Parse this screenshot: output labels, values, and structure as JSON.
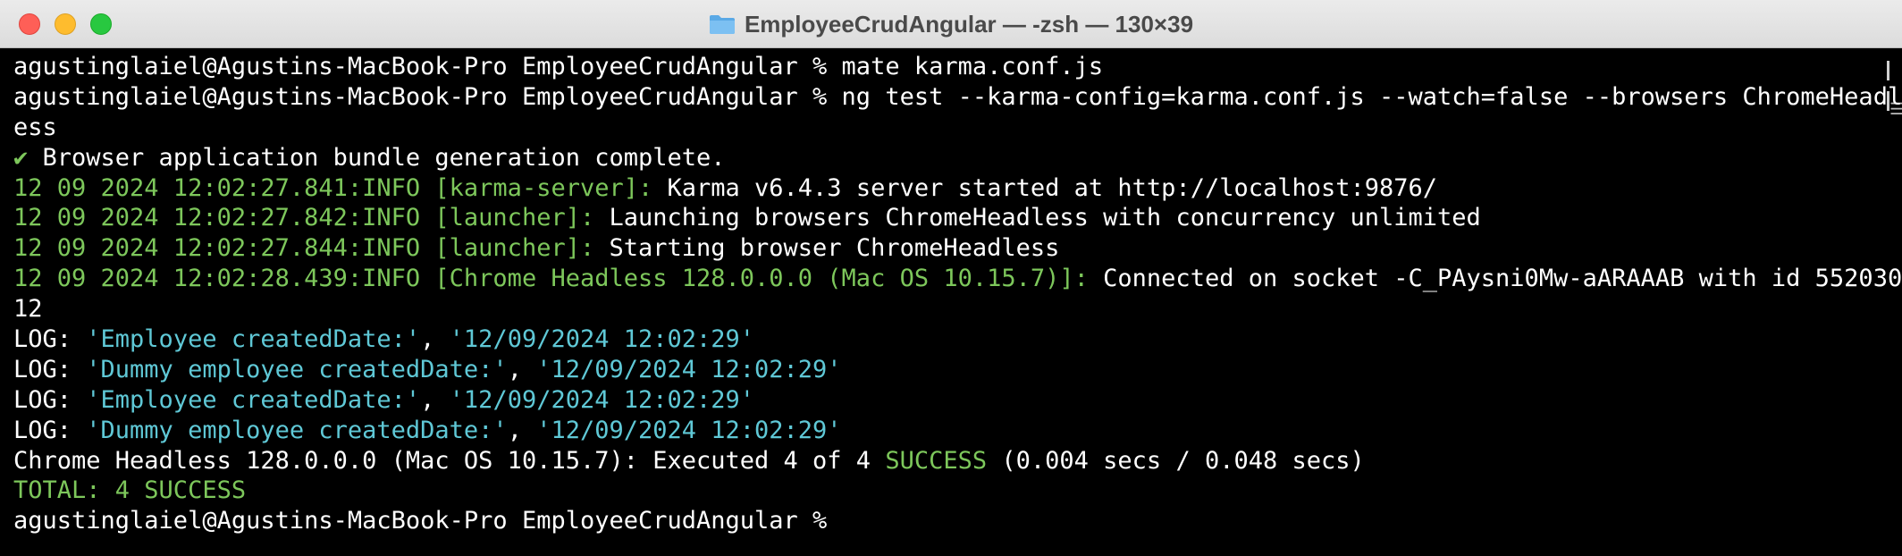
{
  "window": {
    "title": "EmployeeCrudAngular — -zsh — 130×39",
    "icon": "folder-icon"
  },
  "terminal": {
    "lines": [
      [
        {
          "text": "agustinglaiel@Agustins-MacBook-Pro EmployeeCrudAngular % mate karma.conf.js",
          "color": "white"
        }
      ],
      [
        {
          "text": "agustinglaiel@Agustins-MacBook-Pro EmployeeCrudAngular % ng test --karma-config=karma.conf.js --watch=false --browsers ChromeHeadl",
          "color": "white"
        }
      ],
      [
        {
          "text": "ess",
          "color": "white"
        }
      ],
      [
        {
          "text": "✔ ",
          "color": "green"
        },
        {
          "text": "Browser application bundle generation complete.",
          "color": "white"
        }
      ],
      [
        {
          "text": "12 09 2024 12:02:27.841:INFO [karma-server]: ",
          "color": "green"
        },
        {
          "text": "Karma v6.4.3 server started at http://localhost:9876/",
          "color": "white"
        }
      ],
      [
        {
          "text": "12 09 2024 12:02:27.842:INFO [launcher]: ",
          "color": "green"
        },
        {
          "text": "Launching browsers ChromeHeadless with concurrency unlimited",
          "color": "white"
        }
      ],
      [
        {
          "text": "12 09 2024 12:02:27.844:INFO [launcher]: ",
          "color": "green"
        },
        {
          "text": "Starting browser ChromeHeadless",
          "color": "white"
        }
      ],
      [
        {
          "text": "12 09 2024 12:02:28.439:INFO [Chrome Headless 128.0.0.0 (Mac OS 10.15.7)]: ",
          "color": "green"
        },
        {
          "text": "Connected on socket -C_PAysni0Mw-aARAAAB with id 552030",
          "color": "white"
        }
      ],
      [
        {
          "text": "12",
          "color": "white"
        }
      ],
      [
        {
          "text": "LOG: ",
          "color": "white"
        },
        {
          "text": "'Employee createdDate:'",
          "color": "cyan"
        },
        {
          "text": ", ",
          "color": "white"
        },
        {
          "text": "'12/09/2024 12:02:29'",
          "color": "cyan"
        }
      ],
      [
        {
          "text": "LOG: ",
          "color": "white"
        },
        {
          "text": "'Dummy employee createdDate:'",
          "color": "cyan"
        },
        {
          "text": ", ",
          "color": "white"
        },
        {
          "text": "'12/09/2024 12:02:29'",
          "color": "cyan"
        }
      ],
      [
        {
          "text": "LOG: ",
          "color": "white"
        },
        {
          "text": "'Employee createdDate:'",
          "color": "cyan"
        },
        {
          "text": ", ",
          "color": "white"
        },
        {
          "text": "'12/09/2024 12:02:29'",
          "color": "cyan"
        }
      ],
      [
        {
          "text": "LOG: ",
          "color": "white"
        },
        {
          "text": "'Dummy employee createdDate:'",
          "color": "cyan"
        },
        {
          "text": ", ",
          "color": "white"
        },
        {
          "text": "'12/09/2024 12:02:29'",
          "color": "cyan"
        }
      ],
      [
        {
          "text": "Chrome Headless 128.0.0.0 (Mac OS 10.15.7): Executed 4 of 4 ",
          "color": "white"
        },
        {
          "text": "SUCCESS",
          "color": "green"
        },
        {
          "text": " (0.004 secs / 0.048 secs)",
          "color": "white"
        }
      ],
      [
        {
          "text": "TOTAL: 4 SUCCESS",
          "color": "green"
        }
      ],
      [
        {
          "text": "agustinglaiel@Agustins-MacBook-Pro EmployeeCrudAngular % ",
          "color": "white"
        }
      ]
    ]
  },
  "colors": {
    "white": "#ffffff",
    "green": "#7dc75b",
    "cyan": "#5fc8d6",
    "background": "#000000",
    "close": "#fe5f57",
    "minimize": "#febc2e",
    "zoom": "#28c840"
  }
}
